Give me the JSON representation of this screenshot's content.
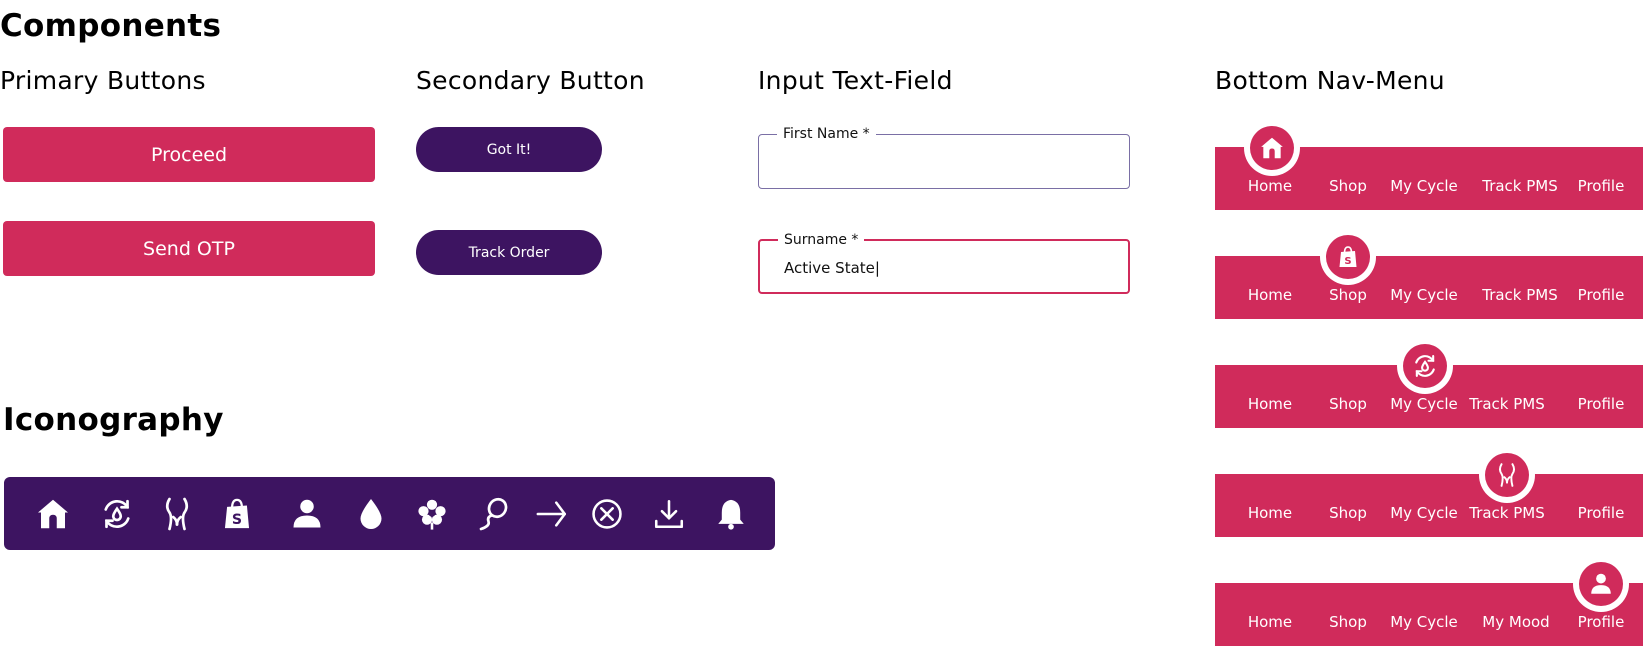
{
  "headings": {
    "components": "Components",
    "iconography": "Iconography"
  },
  "sections": {
    "primary": "Primary Buttons",
    "secondary": "Secondary Button",
    "input": "Input Text-Field",
    "bottom_nav": "Bottom Nav-Menu"
  },
  "primary_buttons": [
    "Proceed",
    "Send OTP"
  ],
  "secondary_buttons": [
    "Got It!",
    "Track Order"
  ],
  "fields": [
    {
      "label": "First Name *",
      "value": ""
    },
    {
      "label": "Surname *",
      "value": "Active State|"
    }
  ],
  "icons": [
    "home-icon",
    "cycle-icon",
    "body-icon",
    "shop-bag-icon",
    "profile-icon",
    "drop-icon",
    "flower-icon",
    "sperm-icon",
    "arrow-right-icon",
    "close-circle-icon",
    "download-icon",
    "bell-icon"
  ],
  "bottom_navs": [
    {
      "items": [
        "Home",
        "Shop",
        "My Cycle",
        "Track PMS",
        "Profile"
      ],
      "active": 0,
      "active_icon": "home-icon"
    },
    {
      "items": [
        "Home",
        "Shop",
        "My Cycle",
        "Track PMS",
        "Profile"
      ],
      "active": 1,
      "active_icon": "shop-bag-icon"
    },
    {
      "items": [
        "Home",
        "Shop",
        "My Cycle",
        "Track PMS",
        "Profile"
      ],
      "active": 2,
      "active_icon": "cycle-icon"
    },
    {
      "items": [
        "Home",
        "Shop",
        "My Cycle",
        "Track PMS",
        "Profile"
      ],
      "active": 3,
      "active_icon": "body-icon"
    },
    {
      "items": [
        "Home",
        "Shop",
        "My Cycle",
        "My Mood",
        "Profile"
      ],
      "active": 4,
      "active_icon": "profile-icon"
    }
  ],
  "colors": {
    "primary": "#d02b5b",
    "secondary": "#3d1461",
    "white": "#ffffff"
  }
}
